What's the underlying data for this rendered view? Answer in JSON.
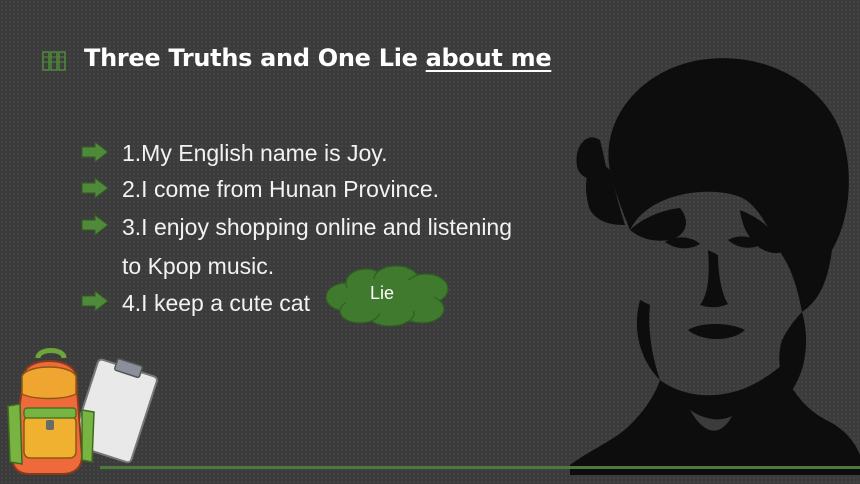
{
  "slide": {
    "title_main": "Three Truths and One Lie ",
    "title_underlined": "about me",
    "items": [
      "1.My English name is Joy.",
      "2.I come from Hunan Province.",
      "3.I enjoy shopping online and listening",
      "to Kpop music.",
      "4.I keep a cute cat"
    ],
    "cloud_label": "Lie"
  },
  "colors": {
    "background": "#3b3b3b",
    "arrow_green": "#4f8a3a",
    "cloud_green": "#3f7a2f",
    "accent_line": "#4c7a3e"
  },
  "icons": [
    "book-icon",
    "arrow-right-icon",
    "woman-silhouette",
    "cloud-shape",
    "backpack-clipboard-illustration"
  ]
}
